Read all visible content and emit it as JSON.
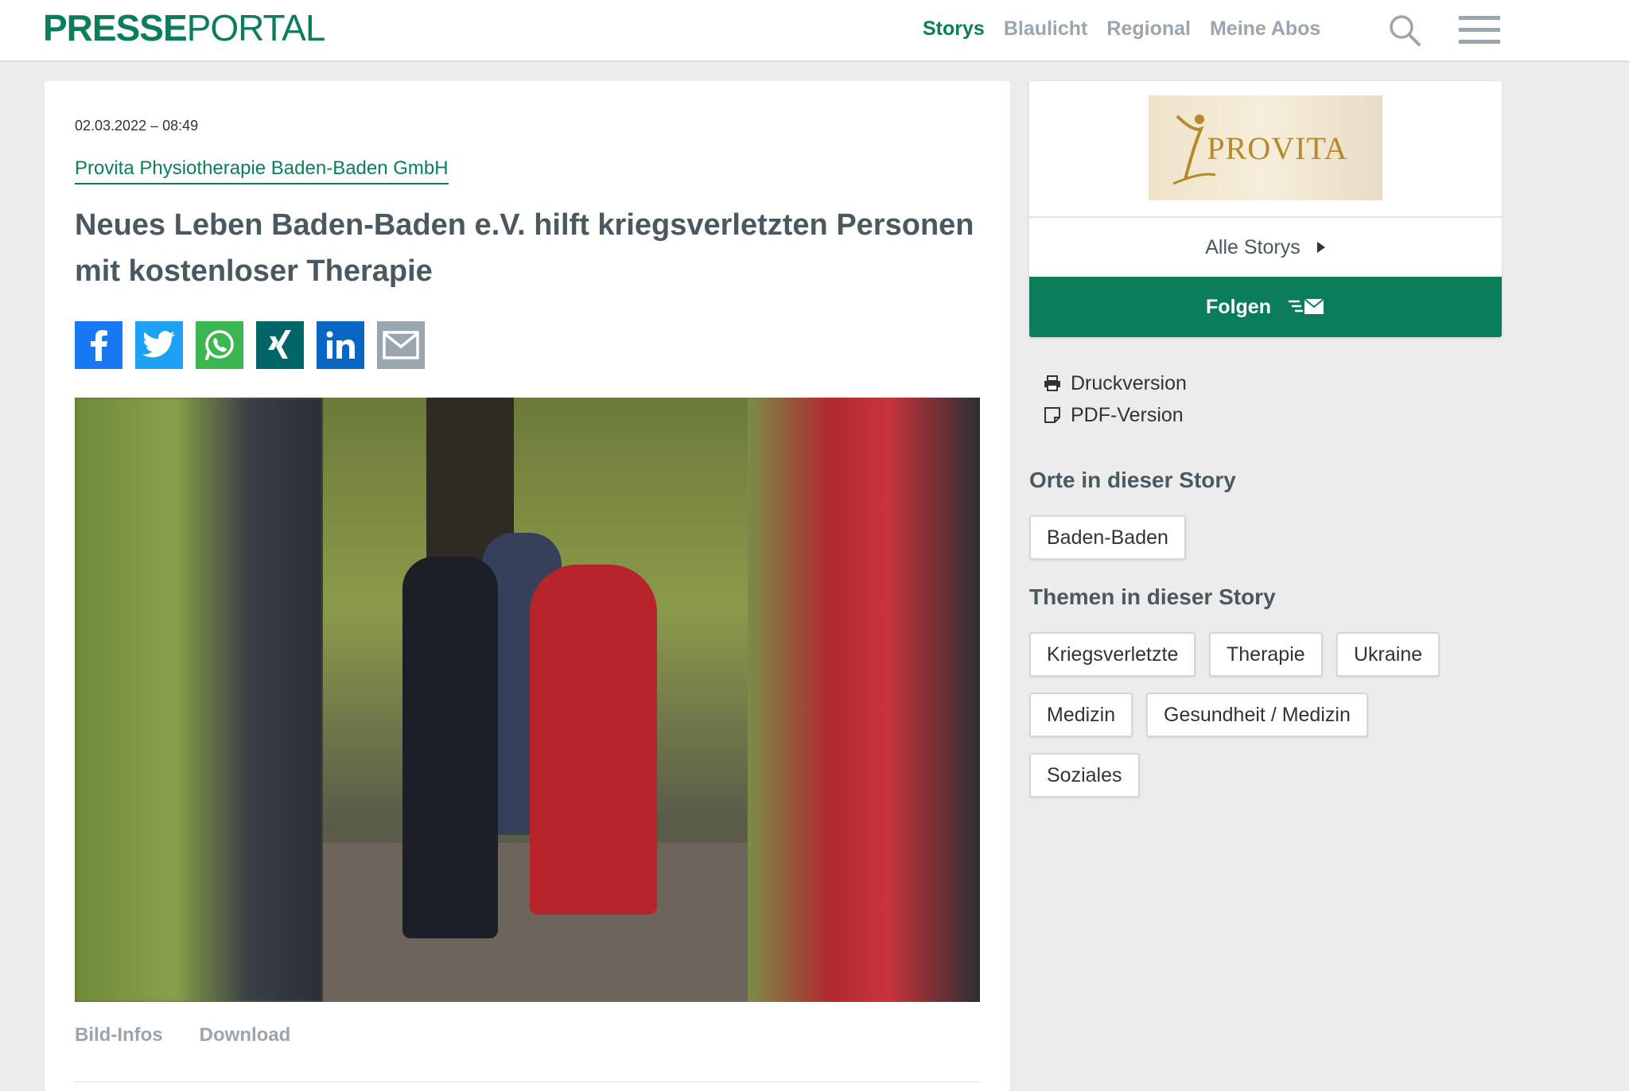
{
  "header": {
    "logo_bold": "PRESSE",
    "logo_light": "PORTAL",
    "nav": [
      "Storys",
      "Blaulicht",
      "Regional",
      "Meine Abos"
    ],
    "active_nav": "Storys",
    "brand_color": "#0b7d5a"
  },
  "article": {
    "date": "02.03.2022 – 08:49",
    "publisher": "Provita Physiotherapie Baden-Baden GmbH",
    "headline": "Neues Leben Baden-Baden e.V. hilft kriegsverletzten Personen mit kostenloser Therapie",
    "share": [
      "facebook-icon",
      "twitter-icon",
      "whatsapp-icon",
      "xing-icon",
      "linkedin-icon",
      "mail-icon"
    ],
    "photo_tabs": [
      "Bild-Infos",
      "Download"
    ]
  },
  "sidebar": {
    "logo_text": "PROVITA",
    "all_storys": "Alle Storys",
    "follow": "Folgen",
    "links": [
      "Druckversion",
      "PDF-Version"
    ],
    "places_heading": "Orte in dieser Story",
    "places": [
      "Baden-Baden"
    ],
    "topics_heading": "Themen in dieser Story",
    "topics": [
      "Kriegsverletzte",
      "Therapie",
      "Ukraine",
      "Medizin",
      "Gesundheit / Medizin",
      "Soziales"
    ]
  }
}
